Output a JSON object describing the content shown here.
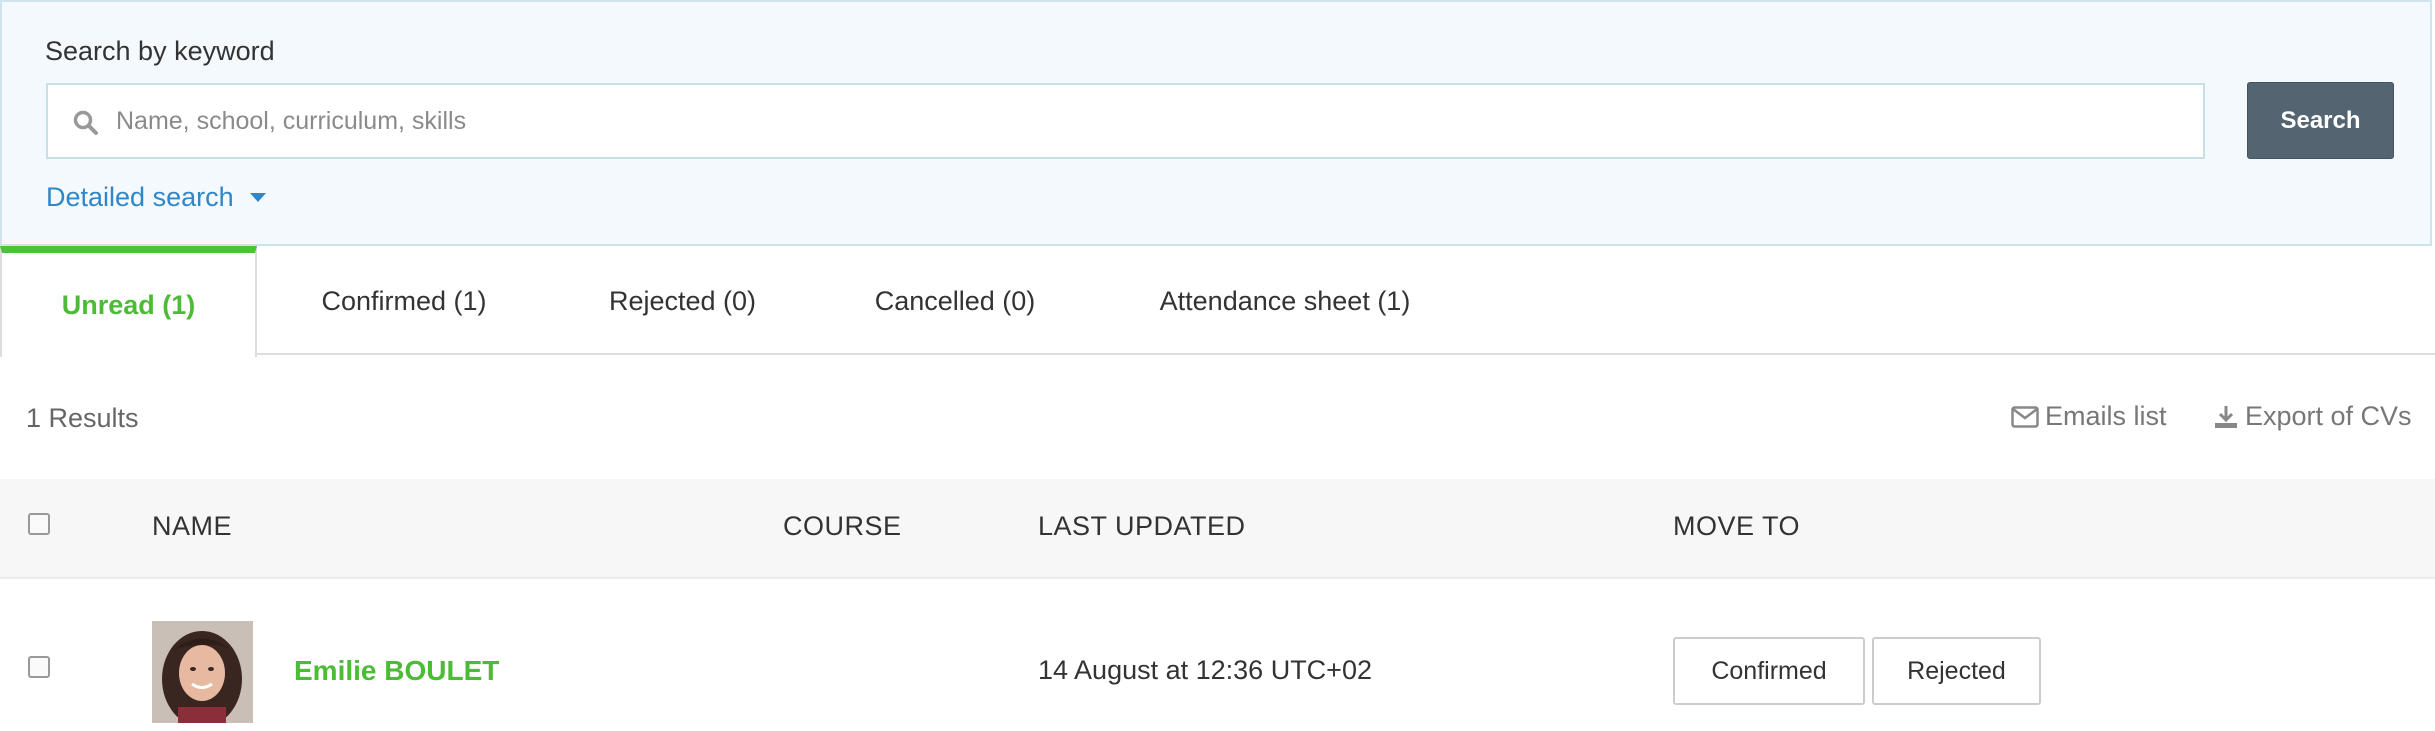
{
  "search": {
    "title": "Search by keyword",
    "placeholder": "Name, school, curriculum, skills",
    "button_label": "Search",
    "detailed_label": "Detailed search"
  },
  "tabs": [
    {
      "label": "Unread (1)",
      "active": true
    },
    {
      "label": "Confirmed (1)",
      "active": false
    },
    {
      "label": "Rejected (0)",
      "active": false
    },
    {
      "label": "Cancelled (0)",
      "active": false
    },
    {
      "label": "Attendance sheet (1)",
      "active": false
    }
  ],
  "results": {
    "count_label": "1 Results",
    "emails_label": "Emails list",
    "export_label": "Export of CVs"
  },
  "table": {
    "headers": {
      "name": "NAME",
      "course": "COURSE",
      "last_updated": "LAST UPDATED",
      "move_to": "MOVE TO"
    },
    "rows": [
      {
        "name": "Emilie BOULET",
        "course": "",
        "last_updated": "14 August at 12:36 UTC+02",
        "actions": [
          "Confirmed",
          "Rejected"
        ]
      }
    ]
  },
  "colors": {
    "accent_green": "#4cbb36",
    "link_blue": "#2f86c8",
    "button_dark": "#546471",
    "panel_bg": "#f3f9fc"
  },
  "icons": {
    "search": "search-icon",
    "caret": "caret-down-icon",
    "emails": "envelope-icon",
    "export": "download-icon"
  }
}
